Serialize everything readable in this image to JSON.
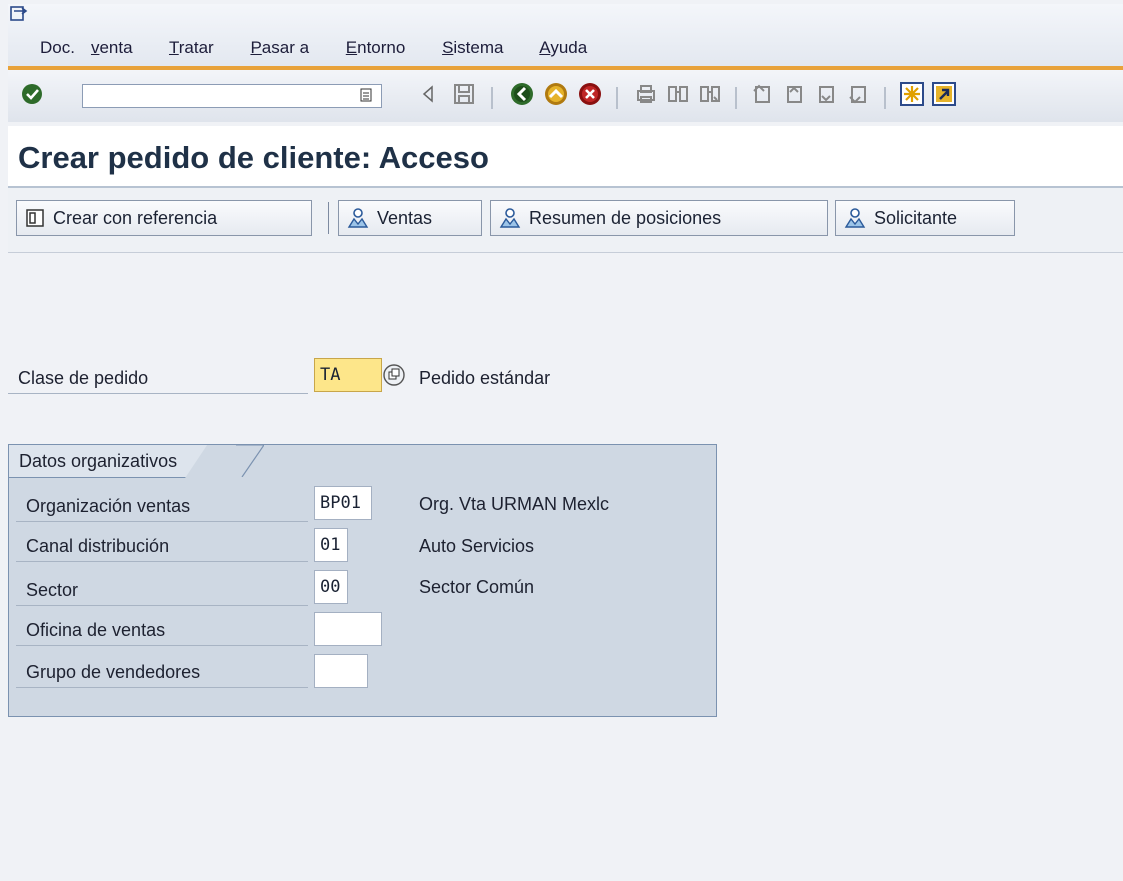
{
  "menu": {
    "items": [
      {
        "pre": "Doc.",
        "u": "v",
        "post": "enta"
      },
      {
        "pre": "",
        "u": "T",
        "post": "ratar"
      },
      {
        "pre": "",
        "u": "P",
        "post": "asar a"
      },
      {
        "pre": "",
        "u": "E",
        "post": "ntorno"
      },
      {
        "pre": "",
        "u": "S",
        "post": "istema"
      },
      {
        "pre": "",
        "u": "A",
        "post": "yuda"
      }
    ]
  },
  "toolbar": {
    "command_field_value": "",
    "icons": [
      "enter-icon",
      "command-field-dropdown-icon",
      "back-arrow-icon",
      "save-icon",
      "back-icon",
      "exit-icon",
      "cancel-icon",
      "print-icon",
      "find-icon",
      "find-next-icon",
      "first-page-icon",
      "previous-page-icon",
      "next-page-icon",
      "last-page-icon",
      "create-session-icon",
      "shortcut-icon"
    ]
  },
  "title": "Crear pedido de cliente: Acceso",
  "app_toolbar": {
    "create_with_reference": "Crear con referencia",
    "sales": "Ventas",
    "item_overview": "Resumen de posiciones",
    "ordering_party": "Solicitante"
  },
  "order_type": {
    "label": "Clase de pedido",
    "value": "TA",
    "description": "Pedido estándar"
  },
  "org_data": {
    "group_title": "Datos organizativos",
    "rows": [
      {
        "label": "Organización ventas",
        "value": "BP01",
        "description": "Org. Vta URMAN Mexlc"
      },
      {
        "label": "Canal distribución",
        "value": "01",
        "description": "Auto Servicios"
      },
      {
        "label": "Sector",
        "value": "00",
        "description": "Sector Común"
      },
      {
        "label": "Oficina de ventas",
        "value": "",
        "description": ""
      },
      {
        "label": "Grupo de vendedores",
        "value": "",
        "description": ""
      }
    ]
  },
  "colors": {
    "accent_orange": "#e8a23a",
    "title_blue": "#1f3147",
    "group_bg": "#cfd8e3",
    "required_field": "#fde68a"
  }
}
